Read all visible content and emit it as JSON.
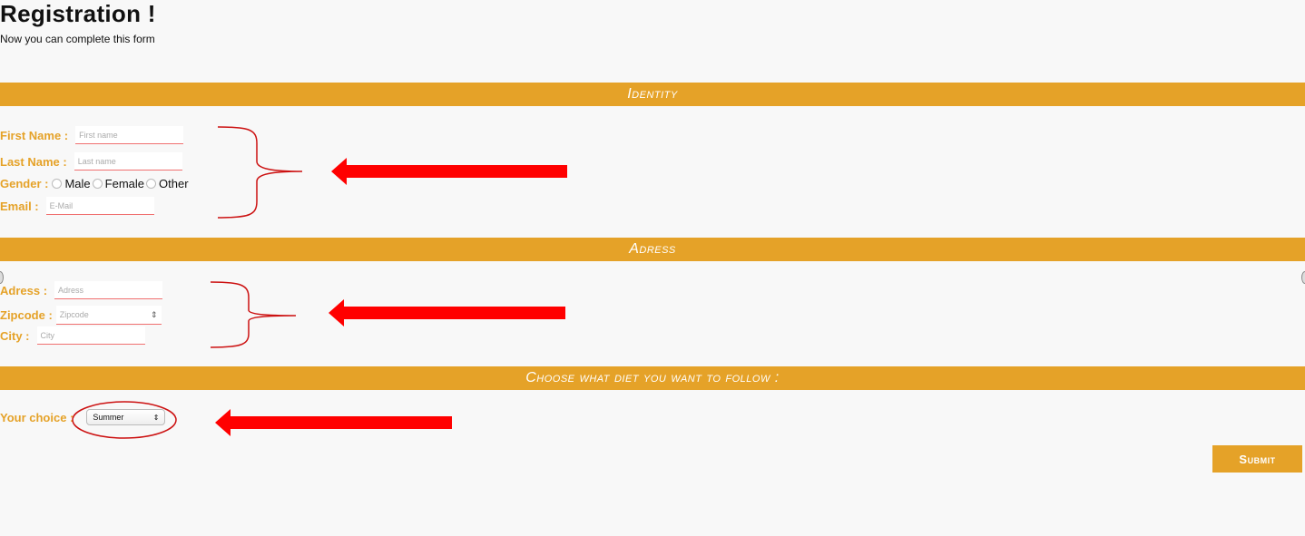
{
  "header": {
    "title": "Registration !",
    "subtitle": "Now you can complete this form"
  },
  "sections": {
    "identity": "Identity",
    "adress": "Adress",
    "diet": "Choose what diet you want to follow :"
  },
  "identity": {
    "first_name": {
      "label": "First Name :",
      "placeholder": "First name"
    },
    "last_name": {
      "label": "Last Name :",
      "placeholder": "Last name"
    },
    "gender": {
      "label": "Gender :",
      "options": [
        "Male",
        "Female",
        "Other"
      ]
    },
    "email": {
      "label": "Email :",
      "placeholder": "E-Mail"
    }
  },
  "address": {
    "adress": {
      "label": "Adress :",
      "placeholder": "Adress"
    },
    "zipcode": {
      "label": "Zipcode :",
      "placeholder": "Zipcode"
    },
    "city": {
      "label": "City :",
      "placeholder": "City"
    }
  },
  "diet": {
    "label": "Your choice :",
    "selected": "Summer"
  },
  "submit_label": "Submit",
  "colors": {
    "accent": "#e5a228",
    "annotation": "#ff0000",
    "background": "#f8f8f8"
  },
  "icons": {
    "radio": "radio-circle-icon",
    "stepper": "stepper-arrows-icon",
    "select": "select-arrows-icon"
  }
}
